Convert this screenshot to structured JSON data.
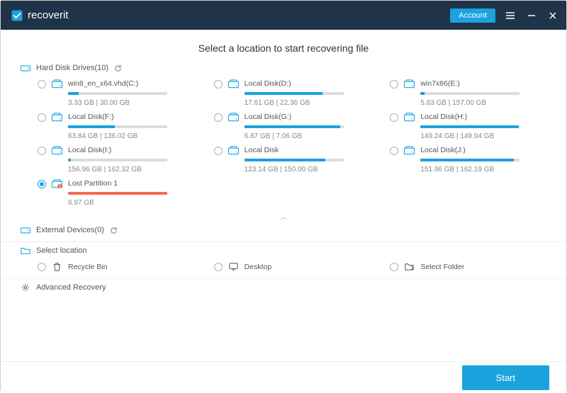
{
  "header": {
    "brand": "recoverit",
    "account_label": "Account"
  },
  "main": {
    "title": "Select a location to start recovering file",
    "hard_disk_label": "Hard Disk Drives(10)",
    "external_label": "External Devices(0)",
    "select_location_label": "Select location",
    "advanced_label": "Advanced Recovery"
  },
  "drives": [
    {
      "name": "win8_en_x64.vhd(C:)",
      "size": "3.33  GB | 30.00  GB",
      "pct": 11,
      "selected": false,
      "lost": false
    },
    {
      "name": "Local Disk(D:)",
      "size": "17.61  GB | 22.36  GB",
      "pct": 79,
      "selected": false,
      "lost": false
    },
    {
      "name": "win7x86(E:)",
      "size": "5.83  GB | 157.00  GB",
      "pct": 4,
      "selected": false,
      "lost": false
    },
    {
      "name": "Local Disk(F:)",
      "size": "63.84  GB | 136.02  GB",
      "pct": 47,
      "selected": false,
      "lost": false
    },
    {
      "name": "Local Disk(G:)",
      "size": "6.87  GB | 7.06  GB",
      "pct": 97,
      "selected": false,
      "lost": false
    },
    {
      "name": "Local Disk(H:)",
      "size": "149.24  GB | 149.94  GB",
      "pct": 99,
      "selected": false,
      "lost": false
    },
    {
      "name": "Local Disk(I:)",
      "size": "156.96  GB | 162.32  GB",
      "pct": 3,
      "selected": false,
      "lost": false
    },
    {
      "name": "Local Disk",
      "size": "123.14  GB | 150.00  GB",
      "pct": 82,
      "selected": false,
      "lost": false
    },
    {
      "name": "Local Disk(J:)",
      "size": "151.96  GB | 162.19  GB",
      "pct": 94,
      "selected": false,
      "lost": false
    },
    {
      "name": "Lost Partition 1",
      "size": "6.97  GB",
      "pct": 100,
      "selected": true,
      "lost": true
    }
  ],
  "select_items": [
    {
      "label": "Recycle Bin",
      "icon": "recycle"
    },
    {
      "label": "Desktop",
      "icon": "desktop"
    },
    {
      "label": "Select Folder",
      "icon": "folder"
    }
  ],
  "footer": {
    "start_label": "Start"
  },
  "colors": {
    "accent": "#1aa3dd",
    "header": "#1f3448",
    "lost": "#f16b52"
  }
}
